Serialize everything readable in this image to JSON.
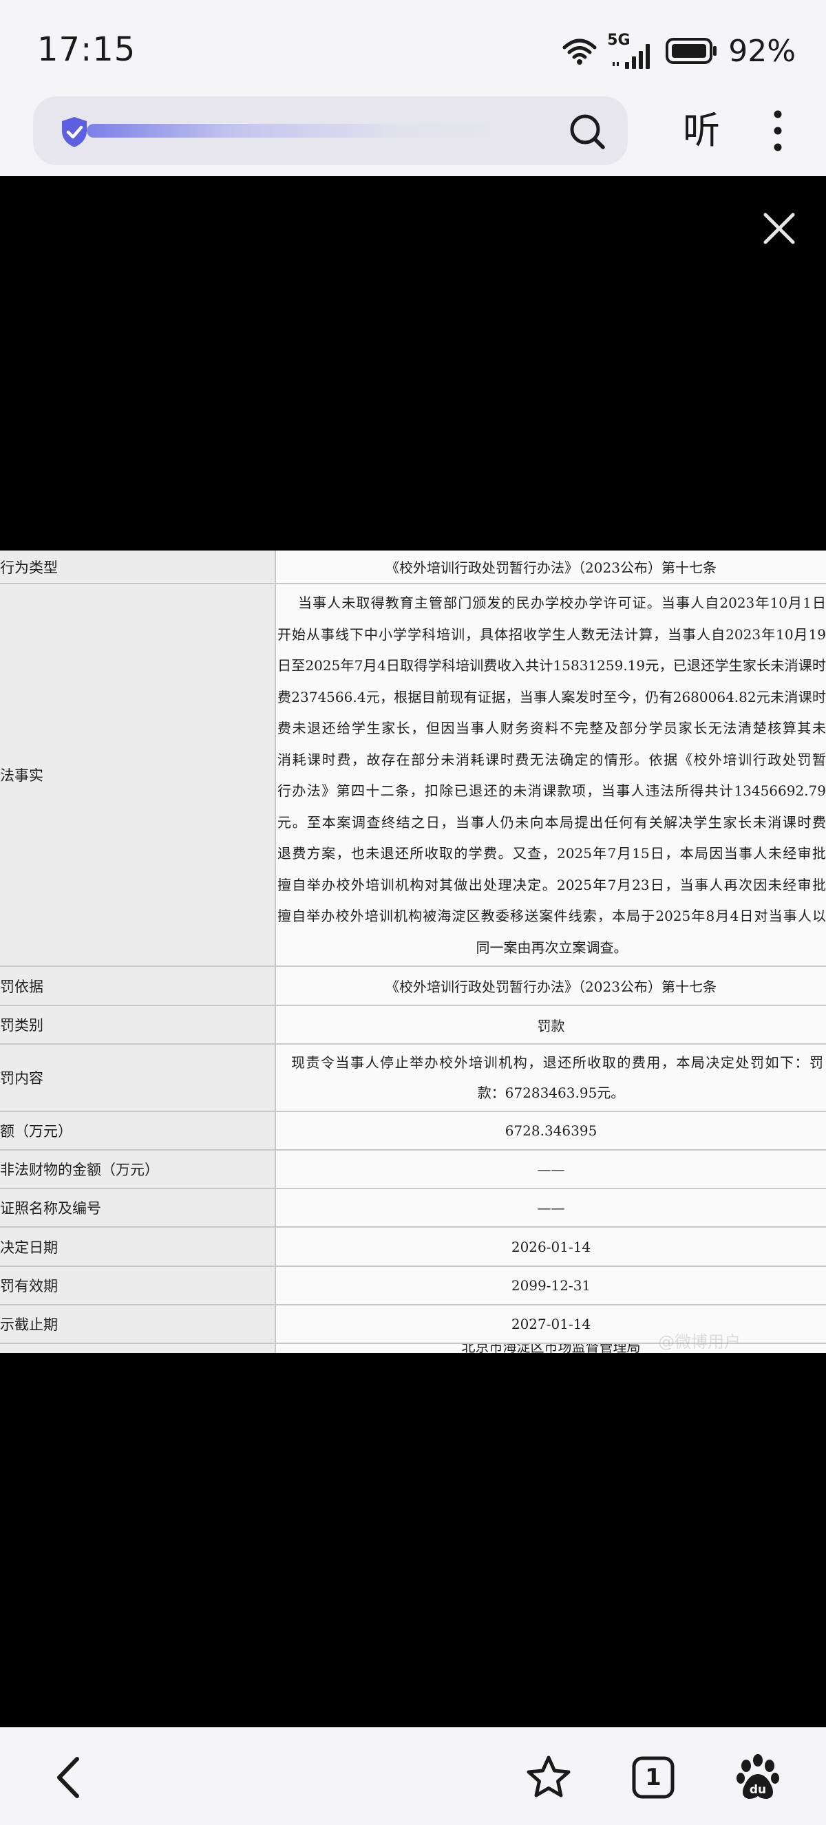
{
  "status_bar": {
    "time": "17:15",
    "network": "5G",
    "battery": "92%",
    "icons": [
      "wifi-icon",
      "signal-icon",
      "battery-icon"
    ]
  },
  "toolbar": {
    "load_progress": 0.55,
    "listen_label": "听",
    "icons": [
      "shield-check-icon",
      "search-icon",
      "more-vert-icon"
    ],
    "accent": "#5b5fe0"
  },
  "viewer": {
    "close_icon": "close-icon"
  },
  "document": {
    "rows": {
      "type": {
        "label": "行为类型",
        "value": "《校外培训行政处罚暂行办法》（2023公布）第十七条"
      },
      "facts": {
        "label": "法事实",
        "lines": [
          "当事人未取得教育主管部门颁发的民办学校办学许可证。当事人自2023年10月1日",
          "开始从事线下中小学学科培训，具体招收学生人数无法计算，当事人自2023年10月19",
          "日至2025年7月4日取得学科培训费收入共计15831259.19元，已退还学生家长未消课时",
          "费2374566.4元，根据目前现有证据，当事人案发时至今，仍有2680064.82元未消课时",
          "费未退还给学生家长，但因当事人财务资料不完整及部分学员家长无法清楚核算其未",
          "消耗课时费，故存在部分未消耗课时费无法确定的情形。依据《校外培训行政处罚暂",
          "行办法》第四十二条，扣除已退还的未消课款项，当事人违法所得共计13456692.79",
          "元。至本案调查终结之日，当事人仍未向本局提出任何有关解决学生家长未消课时费",
          "退费方案，也未退还所收取的学费。又查，2025年7月15日，本局因当事人未经审批",
          "擅自举办校外培训机构对其做出处理决定。2025年7月23日，当事人再次因未经审批",
          "擅自举办校外培训机构被海淀区教委移送案件线索，本局于2025年8月4日对当事人以",
          "同一案由再次立案调查。"
        ]
      },
      "basis": {
        "label": "罚依据",
        "value": "《校外培训行政处罚暂行办法》（2023公布）第十七条"
      },
      "category": {
        "label": "罚类别",
        "value": "罚款"
      },
      "content": {
        "label": "罚内容",
        "lines": [
          "现责令当事人停止举办校外培训机构，退还所收取的费用，本局决定处罚如下：罚",
          "款：67283463.95元。"
        ]
      },
      "amount": {
        "label": "额（万元）",
        "value": "6728.346395"
      },
      "confiscated": {
        "label": "非法财物的金额（万元）",
        "value": "——"
      },
      "license": {
        "label": "证照名称及编号",
        "value": "——"
      },
      "decision_date": {
        "label": "决定日期",
        "value": "2026-01-14"
      },
      "valid": {
        "label": "罚有效期",
        "value": "2099-12-31"
      },
      "public_end": {
        "label": "示截止期",
        "value": "2027-01-14"
      },
      "authority_cut": {
        "value": "北京市海淀区市场监督管理局"
      }
    },
    "watermark": "@微博用户"
  },
  "bottom_nav": {
    "icons": [
      "back-icon",
      "star-icon",
      "tabs-icon",
      "baidu-paw-icon"
    ],
    "tab_count": "1"
  }
}
